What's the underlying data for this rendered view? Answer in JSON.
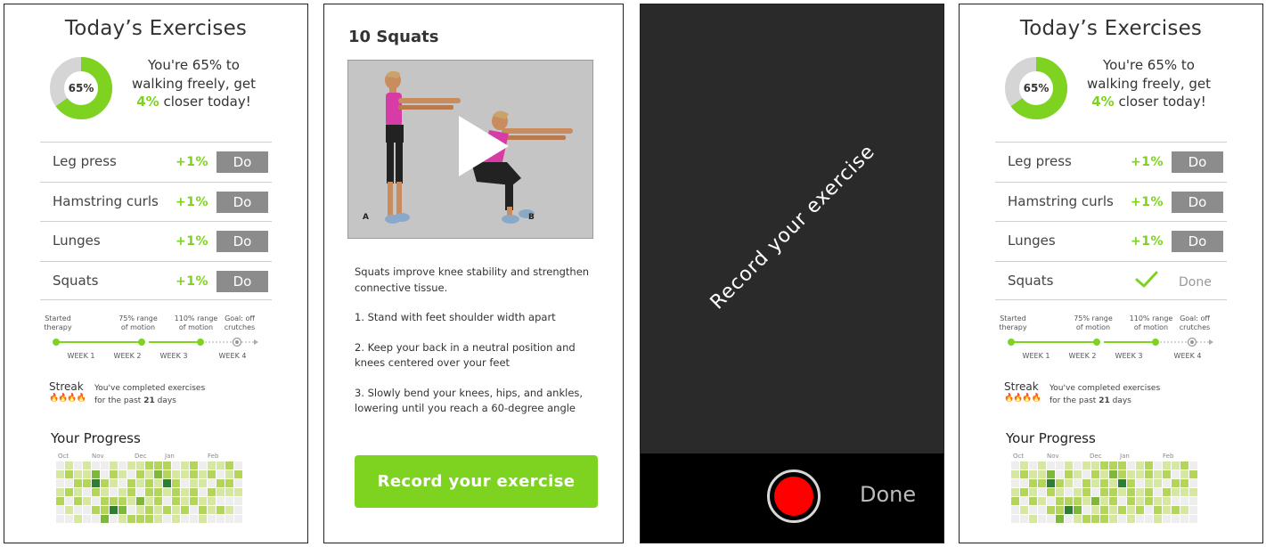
{
  "screen1": {
    "title": "Today’s Exercises",
    "progress_percent": 65,
    "progress_label": "65%",
    "summary_line1": "You're 65% to",
    "summary_line2": "walking freely, get",
    "summary_highlight": "4%",
    "summary_line3": "closer today!",
    "exercises": [
      {
        "name": "Leg press",
        "gain": "+1%",
        "action": "Do"
      },
      {
        "name": "Hamstring curls",
        "gain": "+1%",
        "action": "Do"
      },
      {
        "name": "Lunges",
        "gain": "+1%",
        "action": "Do"
      },
      {
        "name": "Squats",
        "gain": "+1%",
        "action": "Do"
      }
    ],
    "milestones": [
      "Started therapy",
      "75% range of motion",
      "110% range of motion",
      "Goal: off crutches"
    ],
    "weeks": [
      "WEEK 1",
      "WEEK 2",
      "WEEK 3",
      "WEEK 4"
    ],
    "streak_label": "Streak",
    "streak_text_pre": "You've completed exercises",
    "streak_text_mid": "for the past",
    "streak_days": "21",
    "streak_text_post": "days",
    "progress_title": "Your Progress",
    "months": [
      "Oct",
      "Nov",
      "Dec",
      "Jan",
      "Feb"
    ]
  },
  "screen2": {
    "title": "10 Squats",
    "video_label_a": "A",
    "video_label_b": "B",
    "description": "Squats improve knee stability and strengthen connective tissue.",
    "step1": "1. Stand with feet shoulder width apart",
    "step2": "2. Keep your back in a neutral position and knees centered over your feet",
    "step3": "3. Slowly bend your knees, hips, and ankles, lowering until you reach a 60-degree angle",
    "record_button": "Record your exercise"
  },
  "screen3": {
    "overlay_text": "Record your exercise",
    "done_label": "Done"
  },
  "screen4": {
    "title": "Today’s Exercises",
    "progress_percent": 65,
    "progress_label": "65%",
    "summary_line1": "You're 65% to",
    "summary_line2": "walking freely, get",
    "summary_highlight": "4%",
    "summary_line3": "closer today!",
    "exercises": [
      {
        "name": "Leg press",
        "gain": "+1%",
        "action": "Do"
      },
      {
        "name": "Hamstring curls",
        "gain": "+1%",
        "action": "Do"
      },
      {
        "name": "Lunges",
        "gain": "+1%",
        "action": "Do"
      },
      {
        "name": "Squats",
        "status": "Done",
        "icon": "checkmark-icon"
      }
    ],
    "milestones": [
      "Started therapy",
      "75% range of motion",
      "110% range of motion",
      "Goal: off crutches"
    ],
    "weeks": [
      "WEEK 1",
      "WEEK 2",
      "WEEK 3",
      "WEEK 4"
    ],
    "streak_label": "Streak",
    "streak_text_pre": "You've completed exercises",
    "streak_text_mid": "for the past",
    "streak_days": "21",
    "streak_text_post": "days",
    "progress_title": "Your Progress",
    "months": [
      "Oct",
      "Nov",
      "Dec",
      "Jan",
      "Feb"
    ]
  },
  "colors": {
    "accent_green": "#7ed321",
    "button_gray": "#8c8c8c",
    "record_red": "#ff0000",
    "camera_bg": "#2a2a2a",
    "heat_levels": [
      "#eeeeee",
      "#d6e8a0",
      "#b3d65a",
      "#7eb83a",
      "#2f7d32"
    ]
  },
  "heatmap_levels": [
    [
      0,
      1,
      0,
      1,
      0,
      0,
      1,
      0,
      1,
      1,
      2,
      2,
      2,
      0,
      1,
      2,
      0,
      1,
      1,
      2,
      0
    ],
    [
      1,
      2,
      1,
      1,
      3,
      0,
      2,
      1,
      0,
      2,
      1,
      3,
      2,
      1,
      1,
      2,
      1,
      2,
      0,
      1,
      2
    ],
    [
      0,
      0,
      2,
      2,
      4,
      2,
      1,
      0,
      2,
      1,
      2,
      1,
      4,
      2,
      0,
      1,
      1,
      0,
      2,
      2,
      0
    ],
    [
      1,
      2,
      1,
      0,
      2,
      1,
      0,
      1,
      2,
      0,
      2,
      2,
      1,
      2,
      1,
      2,
      0,
      2,
      1,
      1,
      1
    ],
    [
      2,
      0,
      2,
      1,
      0,
      2,
      2,
      2,
      1,
      3,
      1,
      2,
      0,
      2,
      1,
      2,
      1,
      1,
      0,
      0,
      0
    ],
    [
      0,
      1,
      0,
      0,
      2,
      2,
      4,
      3,
      0,
      1,
      2,
      1,
      2,
      1,
      2,
      0,
      2,
      1,
      2,
      1,
      0
    ],
    [
      0,
      0,
      1,
      0,
      0,
      3,
      0,
      1,
      2,
      2,
      2,
      1,
      0,
      1,
      0,
      0,
      1,
      0,
      0,
      0,
      0
    ]
  ]
}
